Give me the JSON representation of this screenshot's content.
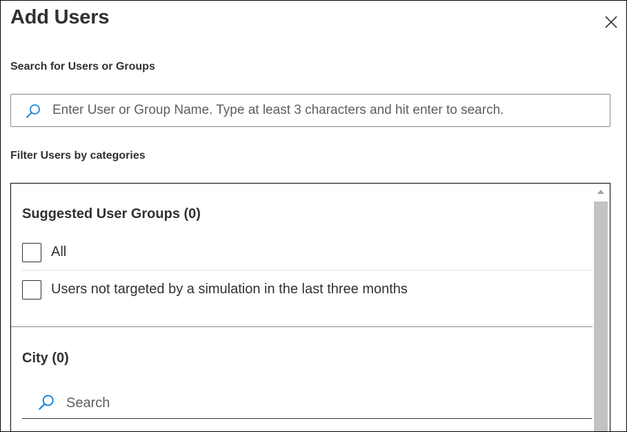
{
  "dialog": {
    "title": "Add Users",
    "close_icon": "close-icon"
  },
  "search": {
    "label": "Search for Users or Groups",
    "placeholder": "Enter User or Group Name. Type at least 3 characters and hit enter to search.",
    "value": "",
    "icon": "search-icon"
  },
  "filter": {
    "label": "Filter Users by categories",
    "suggested_groups": {
      "title": "Suggested User Groups (0)",
      "options": [
        {
          "label": "All",
          "checked": false
        },
        {
          "label": "Users not targeted by a simulation in the last three months",
          "checked": false
        }
      ]
    },
    "city": {
      "title": "City (0)",
      "search_placeholder": "Search",
      "search_value": "",
      "icon": "search-icon"
    }
  },
  "colors": {
    "accent": "#0078d4",
    "text": "#323130",
    "border": "#8a8886",
    "scrollbar_thumb": "#c2c2c2"
  }
}
